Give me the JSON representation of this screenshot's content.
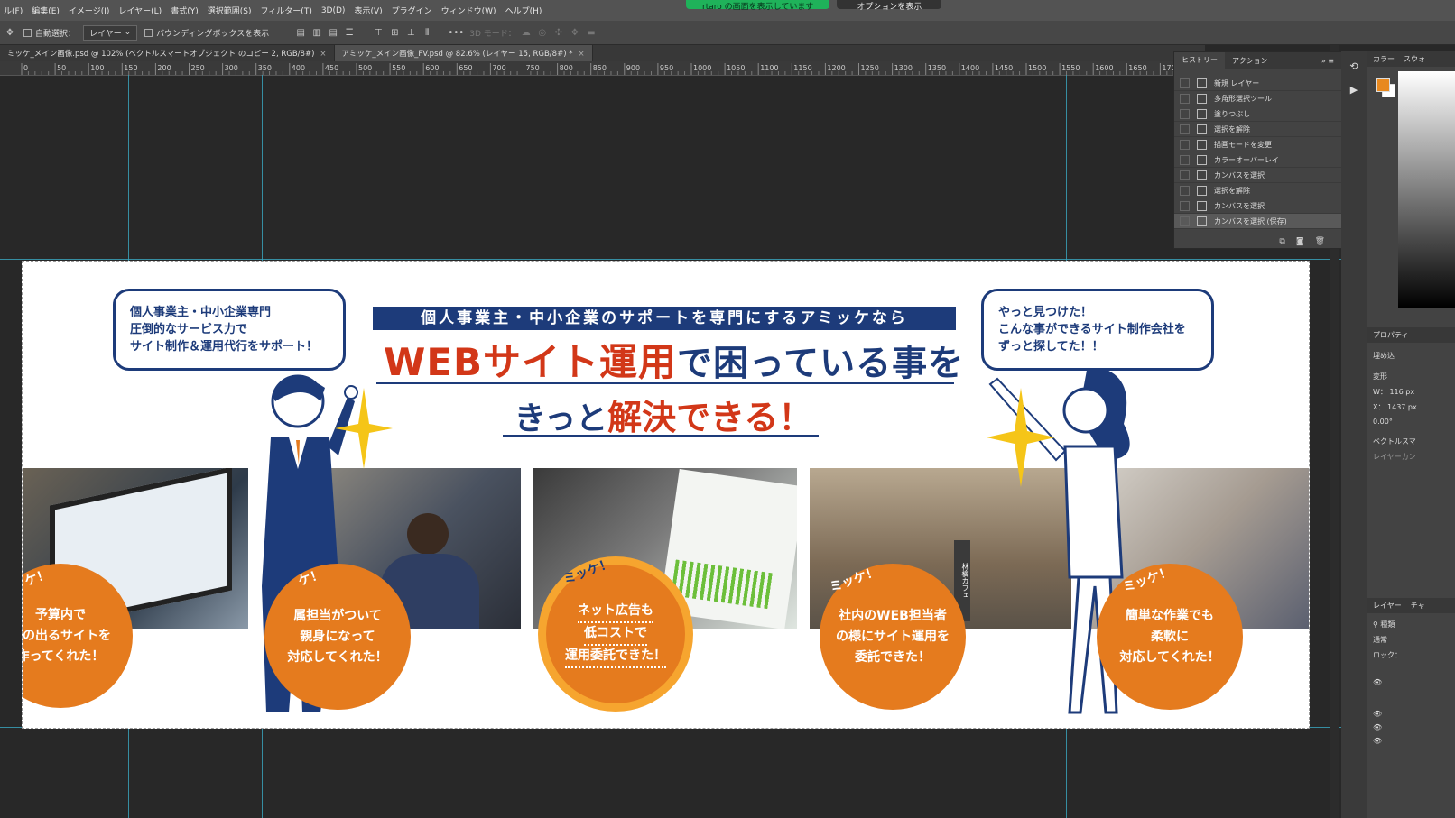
{
  "menu": [
    "ル(F)",
    "編集(E)",
    "イメージ(I)",
    "レイヤー(L)",
    "書式(Y)",
    "選択範囲(S)",
    "フィルター(T)",
    "3D(D)",
    "表示(V)",
    "プラグイン",
    "ウィンドウ(W)",
    "ヘルプ(H)"
  ],
  "share_banner": {
    "showing": "rtaro の画面を表示しています",
    "options": "オプションを表示"
  },
  "options_bar": {
    "auto_select": "自動選択：",
    "layer_select": "レイヤー",
    "bounding_box": "バウンディングボックスを表示",
    "mode_3d": "3D モード："
  },
  "tabs": [
    {
      "label": "ミッケ_メイン画像.psd @ 102% (ベクトルスマートオブジェクト のコピー 2, RGB/8#)",
      "close": "×"
    },
    {
      "label": "アミッケ_メイン画像_FV.psd @ 82.6% (レイヤー 15, RGB/8#) *",
      "close": "×"
    }
  ],
  "ruler_labels": [
    "0",
    "50",
    "100",
    "150",
    "200",
    "250",
    "300",
    "350",
    "400",
    "450",
    "500",
    "550",
    "600",
    "650",
    "700",
    "750",
    "800",
    "850",
    "900",
    "950",
    "1000",
    "1050",
    "1100",
    "1150",
    "1200",
    "1250",
    "1300",
    "1350",
    "1400",
    "1450",
    "1500",
    "1550",
    "1600",
    "1650",
    "170"
  ],
  "banner": {
    "lead": "個人事業主・中小企業のサポートを専門にするアミッケなら",
    "headline_red": "WEBサイト運用",
    "headline_rest": "で困っている事を",
    "sub_pre": "きっと",
    "sub_red": "解決できる！",
    "left_bubble": [
      "個人事業主・中小企業専門",
      "圧倒的なサービス力で",
      "サイト制作＆運用代行をサポート！"
    ],
    "right_bubble": [
      "やっと見つけた！",
      "こんな事ができるサイト制作会社を",
      "ずっと探してた！！"
    ],
    "mikke": "ミッケ！",
    "mikke_partial": "ケ！",
    "circles": [
      [
        "予算内で",
        "果の出るサイトを",
        "作ってくれた！"
      ],
      [
        "属担当がついて",
        "親身になって",
        "対応してくれた！"
      ],
      [
        "ネット広告も",
        "低コストで",
        "運用委託できた！"
      ],
      [
        "社内のWEB担当者",
        "の様にサイト運用を",
        "委託できた！"
      ],
      [
        "簡単な作業でも",
        "柔軟に",
        "対応してくれた！"
      ]
    ],
    "cafe_sign": "林檎カフェ"
  },
  "history": {
    "tabs": [
      "ヒストリー",
      "アクション"
    ],
    "items": [
      "新規 レイヤー",
      "多角形選択ツール",
      "塗りつぶし",
      "選択を解除",
      "描画モードを変更",
      "カラーオーバーレイ",
      "カンバスを選択",
      "選択を解除",
      "カンバスを選択",
      "カンバスを選択 (保存)"
    ],
    "active_index": 9
  },
  "right_panel": {
    "color_tabs": [
      "カラー",
      "スウォ"
    ],
    "props_tab": "プロパティ",
    "embed": "埋め込",
    "shape": "変形",
    "w": "W：  116 px",
    "x": "X：  1437 px",
    "angle": "0.00°",
    "vector": "ベクトルスマ",
    "layer_btn": "レイヤーカン",
    "layers_tabs": [
      "レイヤー",
      "チャ"
    ],
    "kind": "種類",
    "blend": "通常",
    "lock": "ロック："
  },
  "colors": {
    "navy": "#1d3b7a",
    "red": "#d23718",
    "orange": "#e57b1e",
    "accent": "#f6a52f",
    "fg": "#e8891f"
  }
}
